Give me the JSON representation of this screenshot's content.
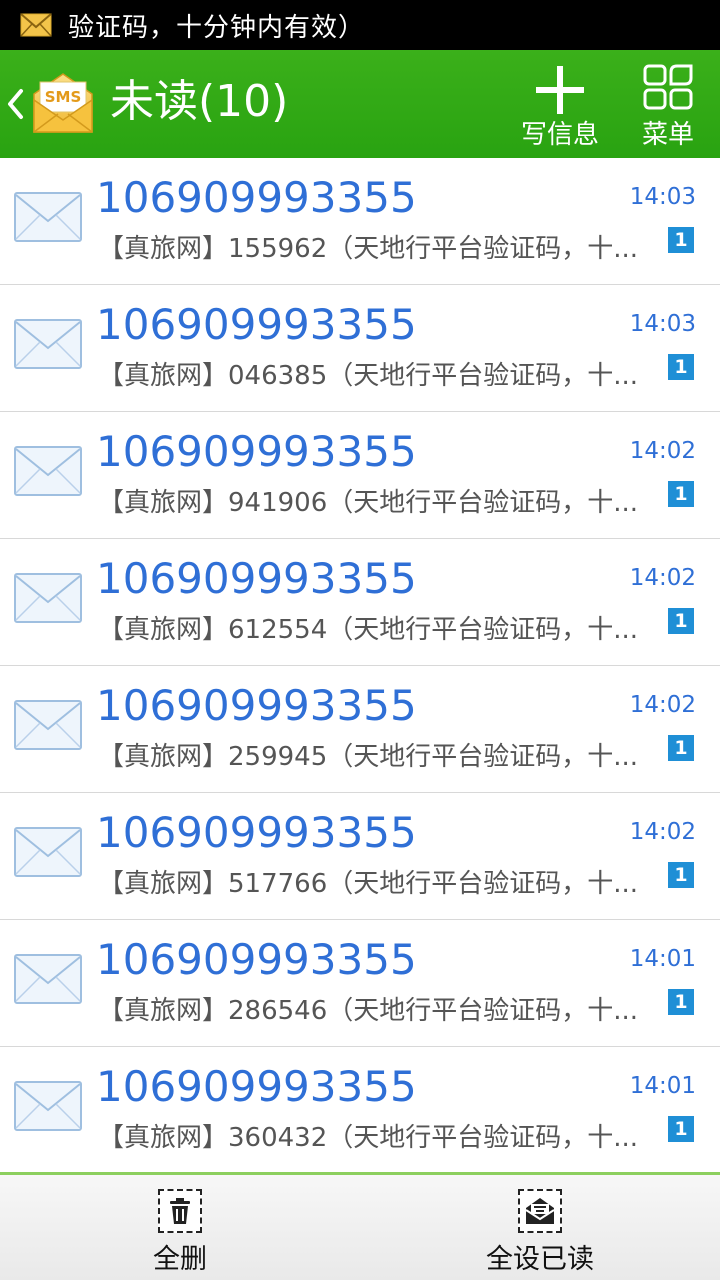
{
  "status_bar": {
    "notification_icon": "mail-icon",
    "notification_text": "验证码，十分钟内有效）"
  },
  "header": {
    "back_icon": "chevron-left-icon",
    "logo_icon": "sms-envelope-icon",
    "logo_text": "SMS",
    "title": "未读(10)",
    "compose_label": "写信息",
    "compose_icon": "plus-icon",
    "menu_label": "菜单",
    "menu_icon": "grid-menu-icon"
  },
  "colors": {
    "header_green": "#2faa14",
    "link_blue": "#2f6fd6",
    "badge_blue": "#1f8fd6"
  },
  "messages": [
    {
      "sender": "106909993355",
      "time": "14:03",
      "preview": "【真旅网】155962（天地行平台验证码，十...",
      "badge": "1"
    },
    {
      "sender": "106909993355",
      "time": "14:03",
      "preview": "【真旅网】046385（天地行平台验证码，十...",
      "badge": "1"
    },
    {
      "sender": "106909993355",
      "time": "14:02",
      "preview": "【真旅网】941906（天地行平台验证码，十...",
      "badge": "1"
    },
    {
      "sender": "106909993355",
      "time": "14:02",
      "preview": "【真旅网】612554（天地行平台验证码，十...",
      "badge": "1"
    },
    {
      "sender": "106909993355",
      "time": "14:02",
      "preview": "【真旅网】259945（天地行平台验证码，十...",
      "badge": "1"
    },
    {
      "sender": "106909993355",
      "time": "14:02",
      "preview": "【真旅网】517766（天地行平台验证码，十...",
      "badge": "1"
    },
    {
      "sender": "106909993355",
      "time": "14:01",
      "preview": "【真旅网】286546（天地行平台验证码，十...",
      "badge": "1"
    },
    {
      "sender": "106909993355",
      "time": "14:01",
      "preview": "【真旅网】360432（天地行平台验证码，十...",
      "badge": "1"
    }
  ],
  "toolbar": {
    "delete_all_label": "全删",
    "delete_all_icon": "trash-icon",
    "mark_all_read_label": "全设已读",
    "mark_all_read_icon": "open-envelope-icon"
  }
}
